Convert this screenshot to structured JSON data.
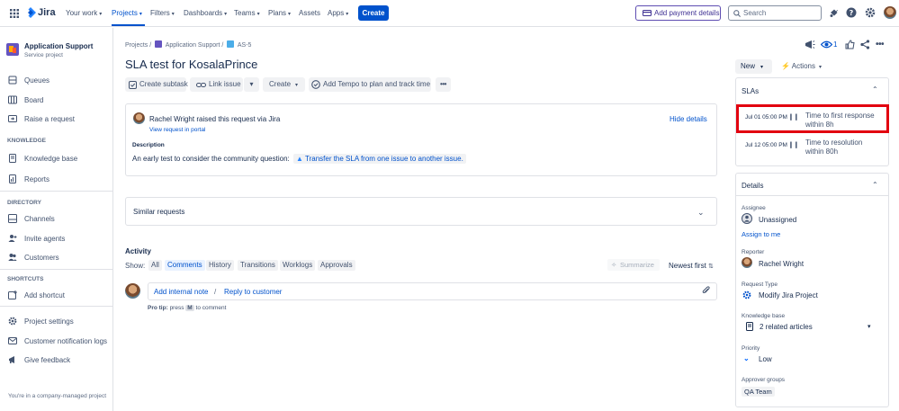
{
  "nav": {
    "logo": "Jira",
    "items": [
      "Your work",
      "Projects",
      "Filters",
      "Dashboards",
      "Teams",
      "Plans",
      "Assets",
      "Apps"
    ],
    "create": "Create",
    "payment": "Add payment details",
    "search_placeholder": "Search"
  },
  "sidebar": {
    "project_name": "Application Support",
    "project_type": "Service project",
    "items_top": [
      "Queues",
      "Board",
      "Raise a request"
    ],
    "knowledge_head": "KNOWLEDGE",
    "items_knowledge": [
      "Knowledge base",
      "Reports"
    ],
    "directory_head": "DIRECTORY",
    "items_directory": [
      "Channels",
      "Invite agents",
      "Customers"
    ],
    "shortcuts_head": "SHORTCUTS",
    "add_shortcut": "Add shortcut",
    "items_bottom": [
      "Project settings",
      "Customer notification logs",
      "Give feedback"
    ],
    "footer": "You're in a company-managed project"
  },
  "breadcrumb": {
    "projects": "Projects",
    "project": "Application Support",
    "issue": "AS-5",
    "sep": "/"
  },
  "issue": {
    "title": "SLA test for KosalaPrince",
    "watch_count": "1",
    "buttons": {
      "subtask": "Create subtask",
      "link": "Link issue",
      "create": "Create",
      "tempo": "Add Tempo to plan and track time"
    }
  },
  "request": {
    "reporter": "Rachel Wright",
    "raised_text": "raised this request via",
    "channel": "Jira",
    "view_portal": "View request in portal",
    "hide": "Hide details",
    "desc_label": "Description",
    "desc_text": "An early test to consider the community question:",
    "desc_link": "Transfer the SLA from one issue to another issue."
  },
  "similar": "Similar requests",
  "activity": {
    "title": "Activity",
    "show": "Show:",
    "tabs": [
      "All",
      "Comments",
      "History",
      "Transitions",
      "Worklogs",
      "Approvals"
    ],
    "summarize": "Summarize",
    "sort": "Newest first",
    "add_internal": "Add internal note",
    "slash": "/",
    "reply": "Reply to customer",
    "protip_label": "Pro tip:",
    "protip_press": "press",
    "protip_key": "M",
    "protip_rest": "to comment"
  },
  "status": {
    "label": "New",
    "actions": "Actions"
  },
  "slas": {
    "title": "SLAs",
    "items": [
      {
        "date": "Jul 01 05:00 PM",
        "name": "Time to first response within 8h"
      },
      {
        "date": "Jul 12 05:00 PM",
        "name": "Time to resolution within 80h"
      }
    ],
    "highlight_color": "#e2000f"
  },
  "details": {
    "title": "Details",
    "assignee_label": "Assignee",
    "assignee": "Unassigned",
    "assign_me": "Assign to me",
    "reporter_label": "Reporter",
    "reporter": "Rachel Wright",
    "request_type_label": "Request Type",
    "request_type": "Modify Jira Project",
    "kb_label": "Knowledge base",
    "kb": "2 related articles",
    "priority_label": "Priority",
    "priority": "Low",
    "approver_label": "Approver groups",
    "approver": "QA Team"
  }
}
